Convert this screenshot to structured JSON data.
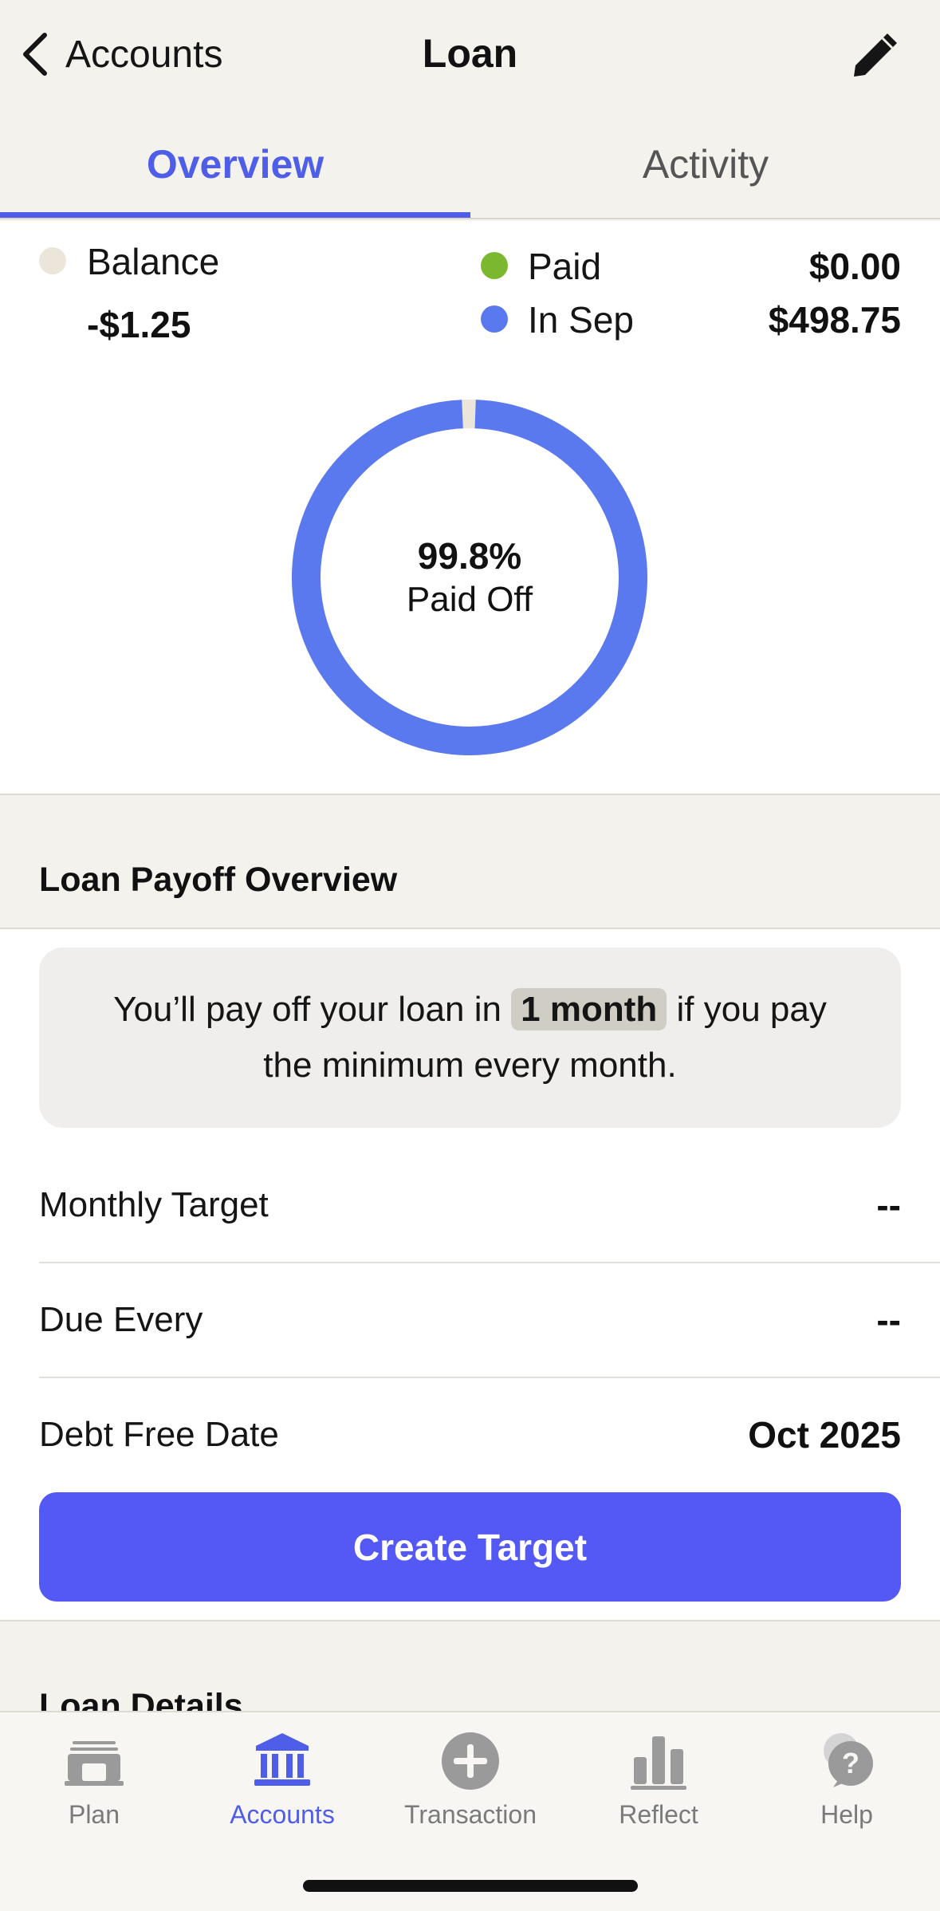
{
  "header": {
    "back_label": "Accounts",
    "title": "Loan"
  },
  "tabs": [
    {
      "label": "Overview",
      "active": true
    },
    {
      "label": "Activity",
      "active": false
    }
  ],
  "summary": {
    "balance_label": "Balance",
    "balance_value": "-$1.25",
    "paid_label": "Paid",
    "paid_value": "$0.00",
    "in_month_label": "In Sep",
    "in_month_value": "$498.75",
    "colors": {
      "balance": "#ebe6d9",
      "paid": "#7cb82f",
      "scheduled": "#5b79ef",
      "accent": "#4f5ee8"
    }
  },
  "donut": {
    "percent_label": "99.8%",
    "subtitle": "Paid Off",
    "fraction_paid": 0.998
  },
  "payoff": {
    "section_title": "Loan Payoff Overview",
    "callout_before": "You’ll pay off your loan in",
    "callout_highlight": "1 month",
    "callout_after": "if you pay the minimum every month.",
    "rows": [
      {
        "label": "Monthly Target",
        "value": "--"
      },
      {
        "label": "Due Every",
        "value": "--"
      },
      {
        "label": "Debt Free Date",
        "value": "Oct 2025"
      }
    ],
    "cta_label": "Create Target"
  },
  "details": {
    "section_title": "Loan Details"
  },
  "tabbar": [
    {
      "label": "Plan",
      "icon": "plan-icon",
      "active": false
    },
    {
      "label": "Accounts",
      "icon": "bank-icon",
      "active": true
    },
    {
      "label": "Transaction",
      "icon": "plus-circle-icon",
      "active": false
    },
    {
      "label": "Reflect",
      "icon": "bar-chart-icon",
      "active": false
    },
    {
      "label": "Help",
      "icon": "help-icon",
      "active": false
    }
  ]
}
